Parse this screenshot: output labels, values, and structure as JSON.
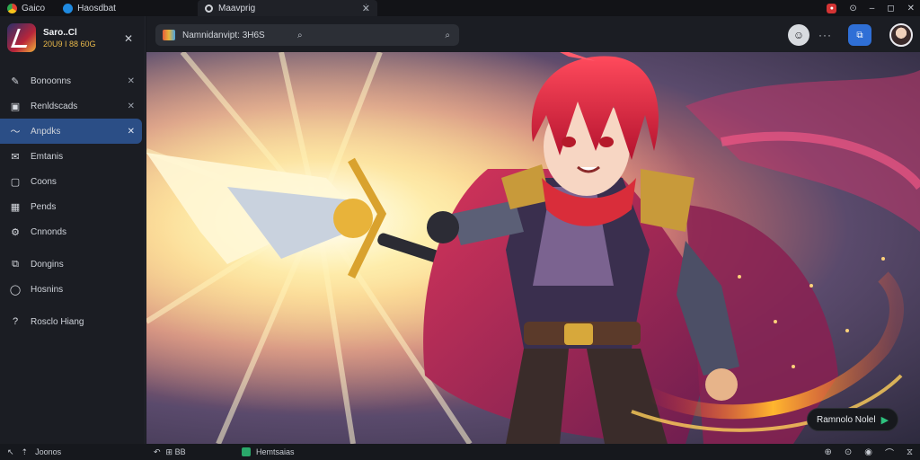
{
  "titlebar": {
    "app1_label": "Gaico",
    "app2_label": "Haosdbat",
    "tab_label": "Maavprig",
    "tab_close": "✕",
    "tab_extra": "⋮",
    "controls": [
      "–",
      "◻",
      "✕"
    ]
  },
  "sidebar": {
    "profile_name": "Saro..Cl",
    "profile_sub": "20U9 I 88 60G",
    "close": "✕",
    "items": [
      {
        "label": "Bonoonns",
        "icon": "brush-icon",
        "glyph": "✎",
        "has_x": true
      },
      {
        "label": "Renldscads",
        "icon": "image-icon",
        "glyph": "▣",
        "has_x": true
      },
      {
        "label": "Anpdks",
        "icon": "chart-icon",
        "glyph": "〜",
        "has_x": true,
        "active": true
      },
      {
        "label": "Emtanis",
        "icon": "envelope-icon",
        "glyph": "✉",
        "has_x": false
      },
      {
        "label": "Coons",
        "icon": "square-icon",
        "glyph": "▢",
        "has_x": false
      },
      {
        "label": "Pends",
        "icon": "grid-icon",
        "glyph": "▦",
        "has_x": false
      },
      {
        "label": "Cnnonds",
        "icon": "settings-icon",
        "glyph": "⚙",
        "has_x": false
      },
      {
        "label": "Dongins",
        "icon": "copy-icon",
        "glyph": "⧉",
        "has_x": false
      },
      {
        "label": "Hosnins",
        "icon": "circle-icon",
        "glyph": "◯",
        "has_x": false
      },
      {
        "label": "Rosclo Hiang",
        "icon": "help-icon",
        "glyph": "?",
        "has_x": false
      }
    ],
    "x_glyph": "✕",
    "footer_label": "Joonos"
  },
  "toolbar": {
    "search_text": "Namnidanvipt: 3H6S",
    "search_glyph": "⌕",
    "dots": "···",
    "blue_btn_glyph": "⧉"
  },
  "cta": {
    "label": "Ramnolo Nolel",
    "arrow": "▶"
  },
  "statusbar": {
    "left_label": "⊞ BB",
    "mid_label": "Hemtsaias",
    "right_glyphs": [
      "⊕",
      "⊙",
      "◉",
      "⌒",
      "⧖"
    ]
  }
}
